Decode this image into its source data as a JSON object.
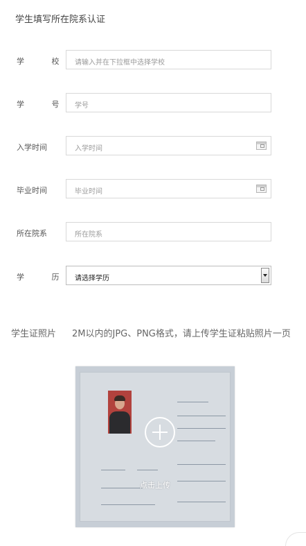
{
  "page": {
    "title": "学生填写所在院系认证"
  },
  "form": {
    "school": {
      "label": "学 校",
      "placeholder": "请输入并在下拉框中选择学校"
    },
    "student_id": {
      "label": "学 号",
      "placeholder": "学号"
    },
    "enroll_date": {
      "label": "入学时间",
      "placeholder": "入学时间",
      "icon": "calendar-icon"
    },
    "grad_date": {
      "label": "毕业时间",
      "placeholder": "毕业时间",
      "icon": "calendar-icon"
    },
    "department": {
      "label": "所在院系",
      "placeholder": "所在院系"
    },
    "education": {
      "label": "学 历",
      "selected": "请选择学历",
      "icon": "dropdown-arrow-icon"
    }
  },
  "photo": {
    "label": "学生证照片",
    "hint": "2M以内的JPG、PNG格式，请上传学生证粘贴照片一页",
    "upload_text": "点击上传",
    "icon": "plus-circle-icon"
  }
}
